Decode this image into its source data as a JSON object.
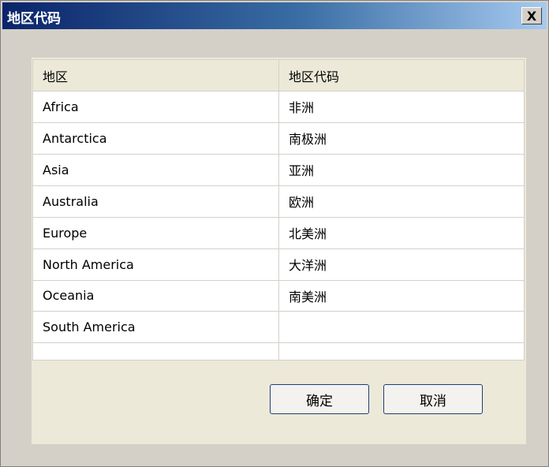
{
  "window": {
    "title": "地区代码",
    "close_label": "X"
  },
  "table": {
    "columns": [
      "地区",
      "地区代码"
    ],
    "rows": [
      [
        "Africa",
        "非洲"
      ],
      [
        "Antarctica",
        "南极洲"
      ],
      [
        "Asia",
        "亚洲"
      ],
      [
        "Australia",
        "欧洲"
      ],
      [
        "Europe",
        "北美洲"
      ],
      [
        "North America",
        "大洋洲"
      ],
      [
        "Oceania",
        "南美洲"
      ],
      [
        "South America",
        ""
      ]
    ]
  },
  "buttons": {
    "ok": "确定",
    "cancel": "取消"
  }
}
